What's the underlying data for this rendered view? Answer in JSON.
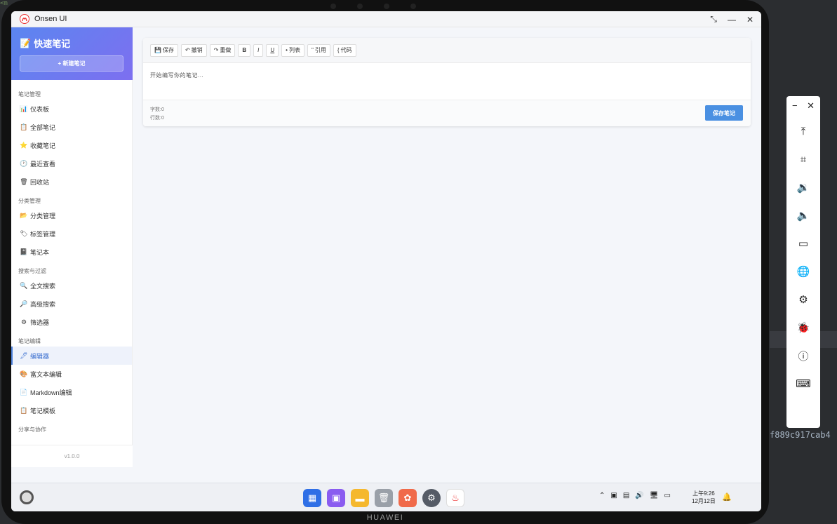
{
  "app": {
    "title": "Onsen UI"
  },
  "window_controls": {
    "restore": "⤡",
    "minimize": "—",
    "close": "✕"
  },
  "sidebar": {
    "brand": "快速笔记",
    "brand_icon": "memo-icon",
    "new_note": "+ 新建笔记",
    "sections": [
      {
        "title": "笔记管理",
        "items": [
          {
            "icon": "📊",
            "label": "仪表板"
          },
          {
            "icon": "📋",
            "label": "全部笔记"
          },
          {
            "icon": "⭐",
            "label": "收藏笔记"
          },
          {
            "icon": "🕐",
            "label": "最近查看"
          },
          {
            "icon": "🗑",
            "label": "回收站"
          }
        ]
      },
      {
        "title": "分类管理",
        "items": [
          {
            "icon": "📂",
            "label": "分类管理"
          },
          {
            "icon": "🏷",
            "label": "标签管理"
          },
          {
            "icon": "📓",
            "label": "笔记本"
          }
        ]
      },
      {
        "title": "搜索与过滤",
        "items": [
          {
            "icon": "🔍",
            "label": "全文搜索"
          },
          {
            "icon": "🔎",
            "label": "高级搜索"
          },
          {
            "icon": "⚙",
            "label": "筛选器"
          }
        ]
      },
      {
        "title": "笔记编辑",
        "items": [
          {
            "icon": "🖊",
            "label": "编辑器",
            "active": true
          },
          {
            "icon": "🎨",
            "label": "富文本编辑"
          },
          {
            "icon": "📄",
            "label": "Markdown编辑"
          },
          {
            "icon": "📋",
            "label": "笔记模板"
          }
        ]
      },
      {
        "title": "分享与协作",
        "items": []
      }
    ],
    "version": "v1.0.0"
  },
  "editor": {
    "toolbar": {
      "save": "保存",
      "undo": "撤销",
      "redo": "重做",
      "bold": "B",
      "italic": "I",
      "underline": "U",
      "list": "列表",
      "quote": "引用",
      "code": "代码"
    },
    "placeholder": "开始编写你的笔记...",
    "word_count": "字数:0",
    "line_count": "行数:0",
    "save_note": "保存笔记"
  },
  "taskbar": {
    "time": "上午9:26",
    "date": "12月12日",
    "dock": [
      {
        "name": "app-grid-icon",
        "color": "#2f6fe6"
      },
      {
        "name": "multitask-icon",
        "color": "#8a5cf0"
      },
      {
        "name": "files-icon",
        "color": "#f5b82e"
      },
      {
        "name": "trash-icon",
        "color": "#9aa0a8"
      },
      {
        "name": "photos-icon",
        "color": "#f06a4a"
      },
      {
        "name": "settings-icon",
        "color": "#555b66"
      },
      {
        "name": "onsen-app-icon",
        "color": "#ffffff"
      }
    ]
  },
  "background": {
    "code_text": "f889c917cab4",
    "top_left": "<m"
  },
  "colors": {
    "accent": "#4a90e2",
    "gradient_start": "#5b86f0",
    "gradient_end": "#7d6ff0"
  }
}
